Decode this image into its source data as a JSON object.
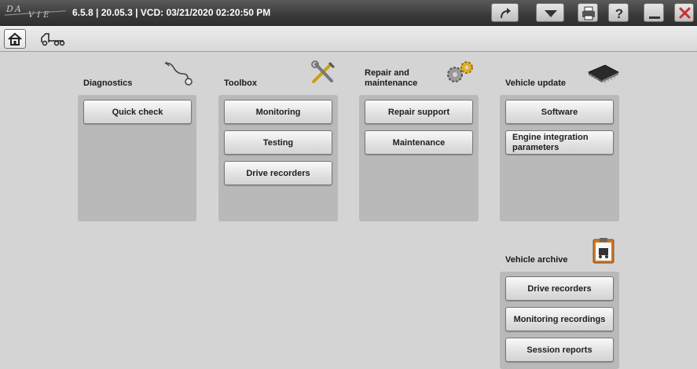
{
  "titlebar": {
    "logo": {
      "line1": "DA",
      "line2": "VIE"
    },
    "info": "6.5.8 | 20.05.3 | VCD: 03/21/2020 02:20:50 PM"
  },
  "colors": {
    "titlebar": "#3a3a3a",
    "background": "#d4d4d4",
    "panel": "#b9b9b9",
    "close": "#c83030"
  },
  "groups": {
    "diagnostics": {
      "title": "Diagnostics",
      "buttons": [
        "Quick check"
      ]
    },
    "toolbox": {
      "title": "Toolbox",
      "buttons": [
        "Monitoring",
        "Testing",
        "Drive recorders"
      ]
    },
    "repair": {
      "title": "Repair and\nmaintenance",
      "buttons": [
        "Repair support",
        "Maintenance"
      ]
    },
    "vehicle_update": {
      "title": "Vehicle update",
      "buttons": [
        "Software",
        "Engine integration\nparameters"
      ]
    },
    "vehicle_archive": {
      "title": "Vehicle archive",
      "buttons": [
        "Drive recorders",
        "Monitoring recordings",
        "Session reports"
      ]
    }
  }
}
